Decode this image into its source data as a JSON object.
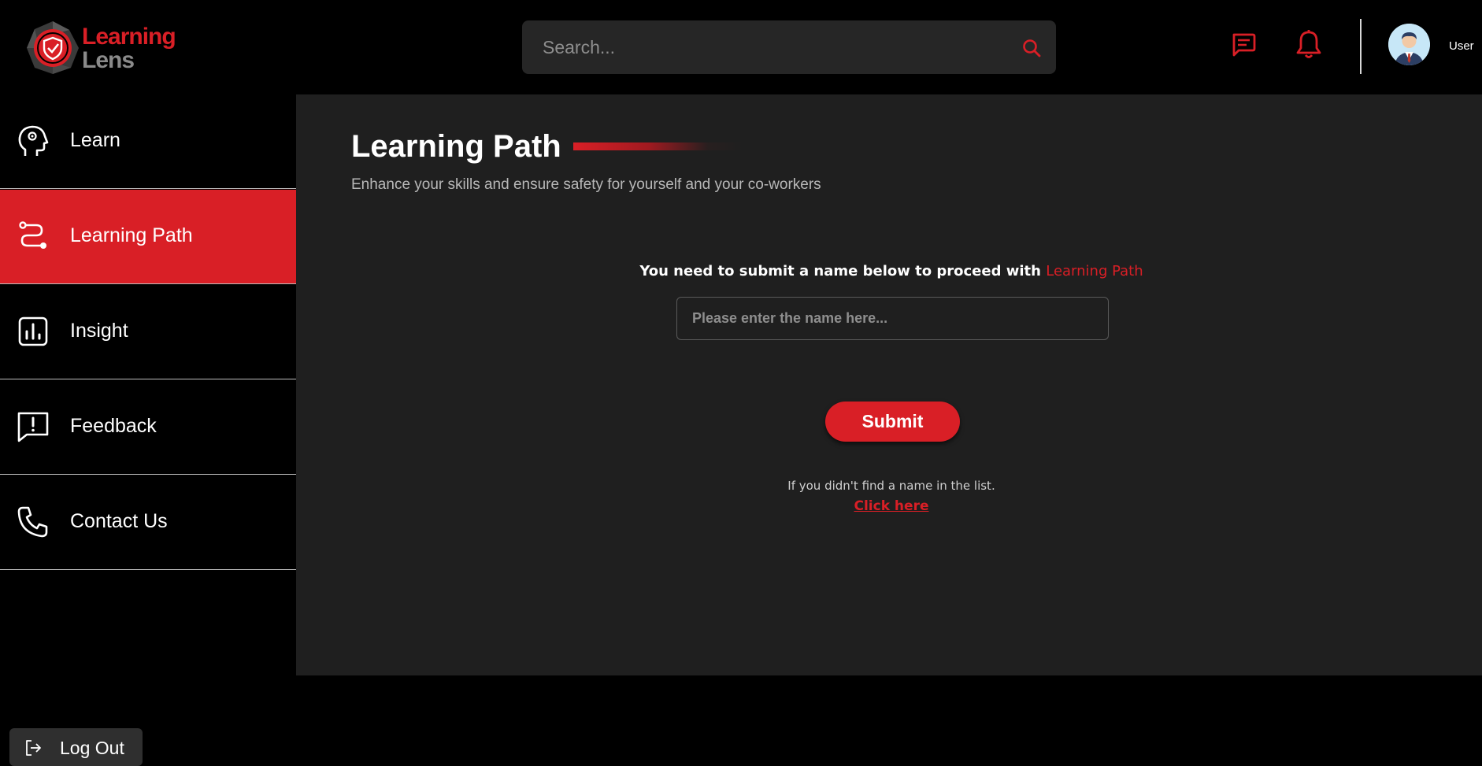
{
  "brand": {
    "line1": "Learning",
    "line2": "Lens"
  },
  "search": {
    "placeholder": "Search..."
  },
  "header": {
    "user_label": "User"
  },
  "sidebar": {
    "items": [
      {
        "label": "Learn",
        "icon": "head-gear-icon",
        "active": false
      },
      {
        "label": "Learning Path",
        "icon": "route-icon",
        "active": true
      },
      {
        "label": "Insight",
        "icon": "chart-icon",
        "active": false
      },
      {
        "label": "Feedback",
        "icon": "feedback-icon",
        "active": false
      },
      {
        "label": "Contact Us",
        "icon": "phone-icon",
        "active": false
      }
    ],
    "logout_label": "Log Out"
  },
  "main": {
    "title": "Learning Path",
    "subtitle": "Enhance your skills and ensure safety for yourself and your co-workers",
    "prompt_text": "You need to submit a name below to proceed with",
    "prompt_highlight": "Learning Path",
    "name_placeholder": "Please enter the name here...",
    "submit_label": "Submit",
    "hint_text": "If you didn't find a name in the list.",
    "click_here_label": "Click here"
  },
  "colors": {
    "accent": "#d91f26",
    "background": "#000000",
    "panel": "#1f1f1f"
  }
}
